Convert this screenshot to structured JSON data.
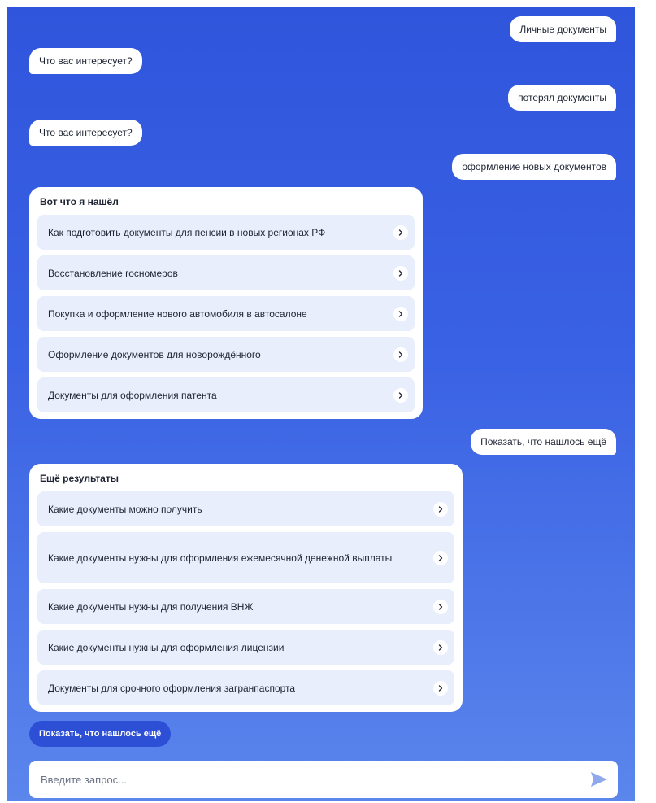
{
  "messages": {
    "user_1": "Личные документы",
    "bot_1": "Что вас интересует?",
    "user_2": "потерял документы",
    "bot_2": "Что вас интересует?",
    "user_3": "оформление новых документов",
    "user_4": "Показать, что нашлось ещё"
  },
  "results_card": {
    "title": "Вот что я нашёл",
    "items": [
      {
        "label": "Как подготовить документы для пенсии в новых регионах РФ"
      },
      {
        "label": "Восстановление госномеров"
      },
      {
        "label": "Покупка и оформление нового автомобиля в автосалоне"
      },
      {
        "label": "Оформление документов для новорождённого"
      },
      {
        "label": "Документы для оформления патента"
      }
    ]
  },
  "more_results_card": {
    "title": "Ещё результаты",
    "items": [
      {
        "label": "Какие документы можно получить"
      },
      {
        "label": "Какие документы нужны для оформления ежемесячной денежной выплаты"
      },
      {
        "label": "Какие документы нужны для получения ВНЖ"
      },
      {
        "label": "Какие документы нужны для оформления лицензии"
      },
      {
        "label": "Документы для срочного оформления загранпаспорта"
      }
    ]
  },
  "show_more_button": "Показать, что нашлось ещё",
  "input": {
    "placeholder": "Введите запрос...",
    "value": ""
  },
  "icons": {
    "chevron": "chevron-right-icon",
    "send": "send-icon"
  },
  "colors": {
    "background_top": "#2f55dc",
    "background_bottom": "#5b86ec",
    "item_background": "#e8eefb",
    "button": "#2c4fd6",
    "send_icon": "#8fa8ee"
  }
}
